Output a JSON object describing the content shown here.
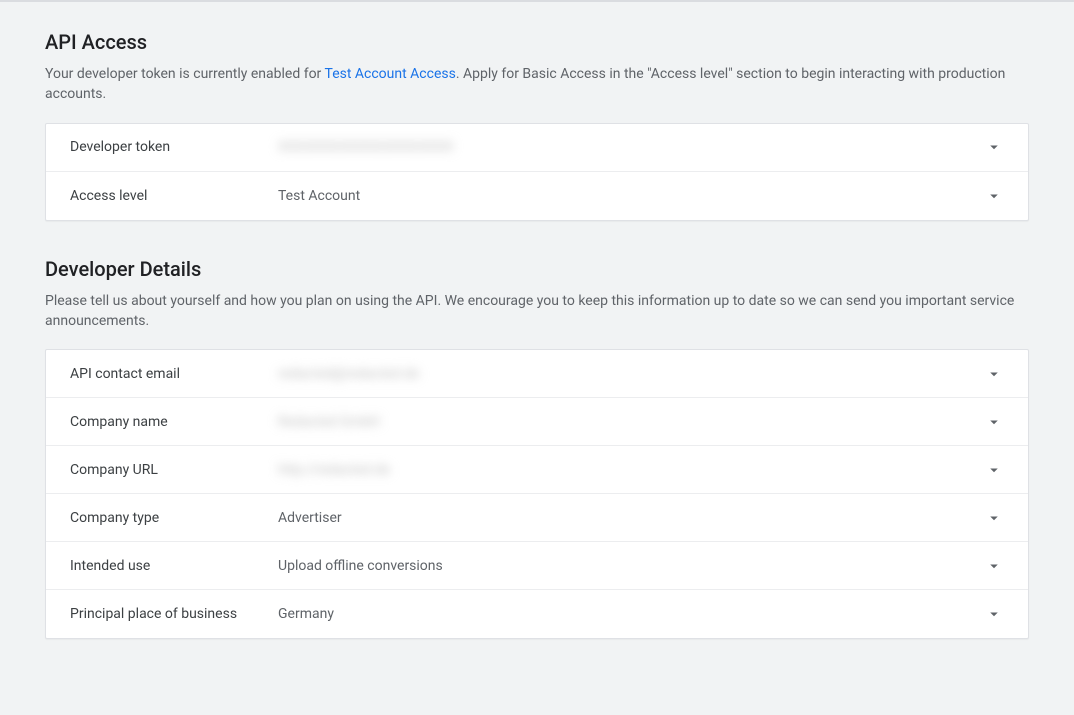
{
  "api_access": {
    "title": "API Access",
    "desc_before": "Your developer token is currently enabled for ",
    "desc_link": "Test Account Access",
    "desc_after": ". Apply for Basic Access in the \"Access level\" section to begin interacting with production accounts.",
    "rows": {
      "developer_token": {
        "label": "Developer token",
        "value": "XXXXXXXXXXXXXXXXXXXX"
      },
      "access_level": {
        "label": "Access level",
        "value": "Test Account"
      }
    }
  },
  "developer_details": {
    "title": "Developer Details",
    "desc": "Please tell us about yourself and how you plan on using the API. We encourage you to keep this information up to date so we can send you important service announcements.",
    "rows": {
      "api_contact_email": {
        "label": "API contact email",
        "value": "redacted@redacted.de"
      },
      "company_name": {
        "label": "Company name",
        "value": "Redacted GmbH"
      },
      "company_url": {
        "label": "Company URL",
        "value": "http://redacted.de"
      },
      "company_type": {
        "label": "Company type",
        "value": "Advertiser"
      },
      "intended_use": {
        "label": "Intended use",
        "value": "Upload offline conversions"
      },
      "principal_place": {
        "label": "Principal place of business",
        "value": "Germany"
      }
    }
  }
}
